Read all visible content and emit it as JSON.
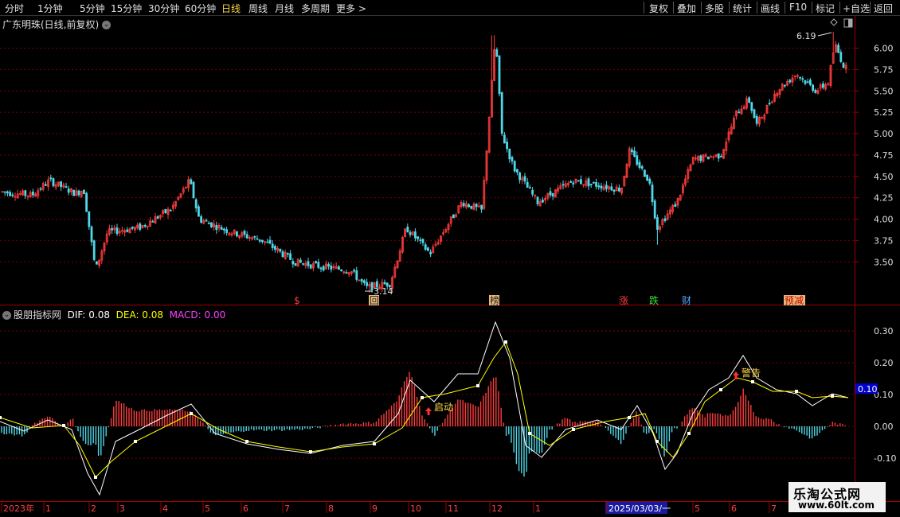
{
  "toolbar": {
    "periods": [
      "分时",
      "1分钟",
      "5分钟",
      "15分钟",
      "30分钟",
      "60分钟",
      "日线",
      "周线",
      "月线",
      "多周期",
      "更多"
    ],
    "active_period": "日线",
    "more_arrow": "chevron-right-icon",
    "right_buttons": [
      "复权",
      "叠加",
      "多股",
      "统计",
      "画线",
      "F10",
      "标记",
      "+自选",
      "返回"
    ]
  },
  "main_chart": {
    "title": "广东明珠(日线,前复权)",
    "high_label": "6.19",
    "low_label": "3.14",
    "y_ticks": [
      "6.00",
      "5.75",
      "5.50",
      "5.25",
      "5.00",
      "4.75",
      "4.50",
      "4.25",
      "4.00",
      "3.75",
      "3.50"
    ],
    "event_markers": [
      "$",
      "回",
      "榜",
      "涨",
      "跌",
      "财",
      "预减"
    ]
  },
  "indicator": {
    "name": "股朋指标网",
    "dif_label": "DIF: 0.08",
    "dea_label": "DEA: 0.08",
    "macd_label": "MACD: 0.00",
    "y_ticks": [
      "0.30",
      "0.20",
      "0.10",
      "0.00",
      "-0.10"
    ],
    "current_value": "0.10",
    "signal_start": "启动",
    "signal_warn": "警告"
  },
  "time_axis": {
    "labels": [
      "2023年",
      "1",
      "2",
      "3",
      "4",
      "5",
      "6",
      "7",
      "8",
      "9",
      "10",
      "11",
      "12",
      "1",
      "2025/03/03/一",
      "5",
      "6",
      "7"
    ]
  },
  "watermark": {
    "title": "乐淘公式网",
    "url": "www.60lt.com"
  },
  "colors": {
    "up": "#ff3c3c",
    "down": "#4fd8e8",
    "dif": "#ffffff",
    "dea": "#ffff00",
    "macd": "#ff40ff",
    "grid": "#7a0000"
  },
  "chart_data": {
    "type": "candlestick+macd",
    "price_range": [
      3.14,
      6.19
    ],
    "indicator_range": [
      -0.15,
      0.33
    ],
    "key_prices": {
      "high": 6.19,
      "low": 3.14,
      "spike": 6.15,
      "last": 5.75
    }
  }
}
